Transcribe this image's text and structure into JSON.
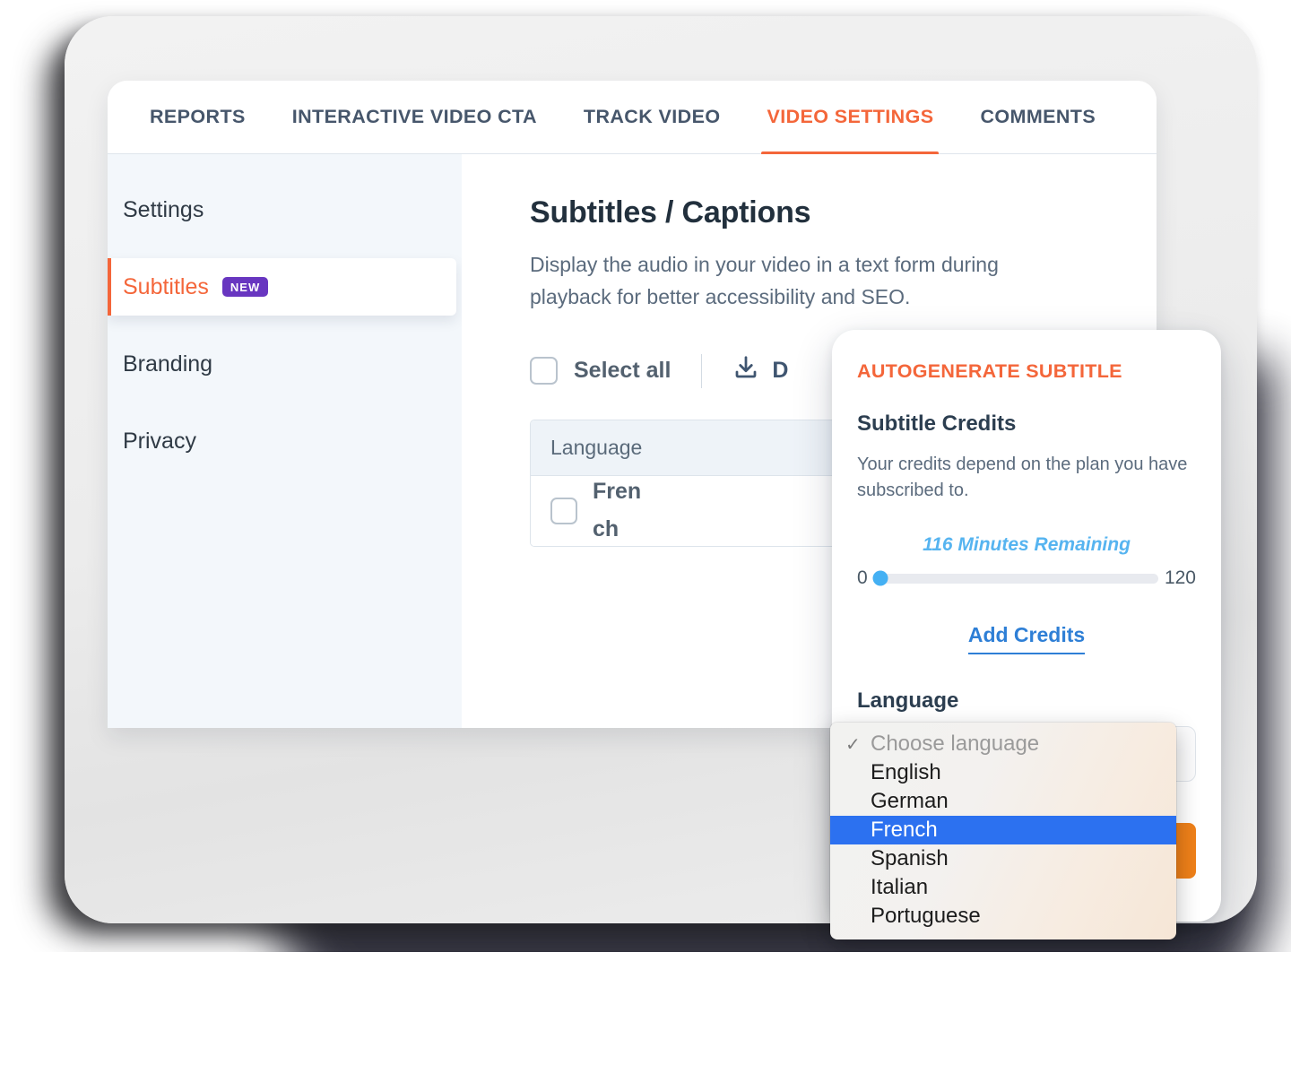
{
  "tabs": [
    {
      "label": "REPORTS",
      "active": false
    },
    {
      "label": "INTERACTIVE VIDEO CTA",
      "active": false
    },
    {
      "label": "TRACK VIDEO",
      "active": false
    },
    {
      "label": "VIDEO SETTINGS",
      "active": true
    },
    {
      "label": "COMMENTS",
      "active": false
    }
  ],
  "sidebar": {
    "items": [
      {
        "label": "Settings",
        "badge": ""
      },
      {
        "label": "Subtitles",
        "badge": "NEW"
      },
      {
        "label": "Branding",
        "badge": ""
      },
      {
        "label": "Privacy",
        "badge": ""
      }
    ]
  },
  "main": {
    "title": "Subtitles / Captions",
    "description": "Display the audio in your video in a text form during playback for better accessibility and SEO.",
    "select_all_label": "Select all",
    "download_label": "D",
    "table": {
      "column_header": "Language",
      "rows": [
        {
          "language": "French"
        }
      ]
    }
  },
  "panel": {
    "title": "AUTOGENERATE SUBTITLE",
    "credits_heading": "Subtitle Credits",
    "credits_text": "Your credits depend on the plan you have subscribed to.",
    "remaining_label": "116 Minutes Remaining",
    "slider_min": "0",
    "slider_max": "120",
    "slider_value": 116,
    "add_credits_label": "Add Credits",
    "language_label": "Language"
  },
  "dropdown": {
    "options": [
      {
        "label": "Choose language",
        "placeholder": true,
        "checked": true,
        "selected": false
      },
      {
        "label": "English",
        "placeholder": false,
        "checked": false,
        "selected": false
      },
      {
        "label": "German",
        "placeholder": false,
        "checked": false,
        "selected": false
      },
      {
        "label": "French",
        "placeholder": false,
        "checked": false,
        "selected": true
      },
      {
        "label": "Spanish",
        "placeholder": false,
        "checked": false,
        "selected": false
      },
      {
        "label": "Italian",
        "placeholder": false,
        "checked": false,
        "selected": false
      },
      {
        "label": "Portuguese",
        "placeholder": false,
        "checked": false,
        "selected": false
      }
    ]
  },
  "colors": {
    "accent_orange": "#f4663a",
    "badge_purple": "#6836c0",
    "link_blue": "#2e7fd6",
    "slider_blue": "#44b0f3",
    "highlight_blue": "#2c71f0",
    "button_orange": "#ef8019",
    "sidebar_bg": "#f3f7fb"
  }
}
